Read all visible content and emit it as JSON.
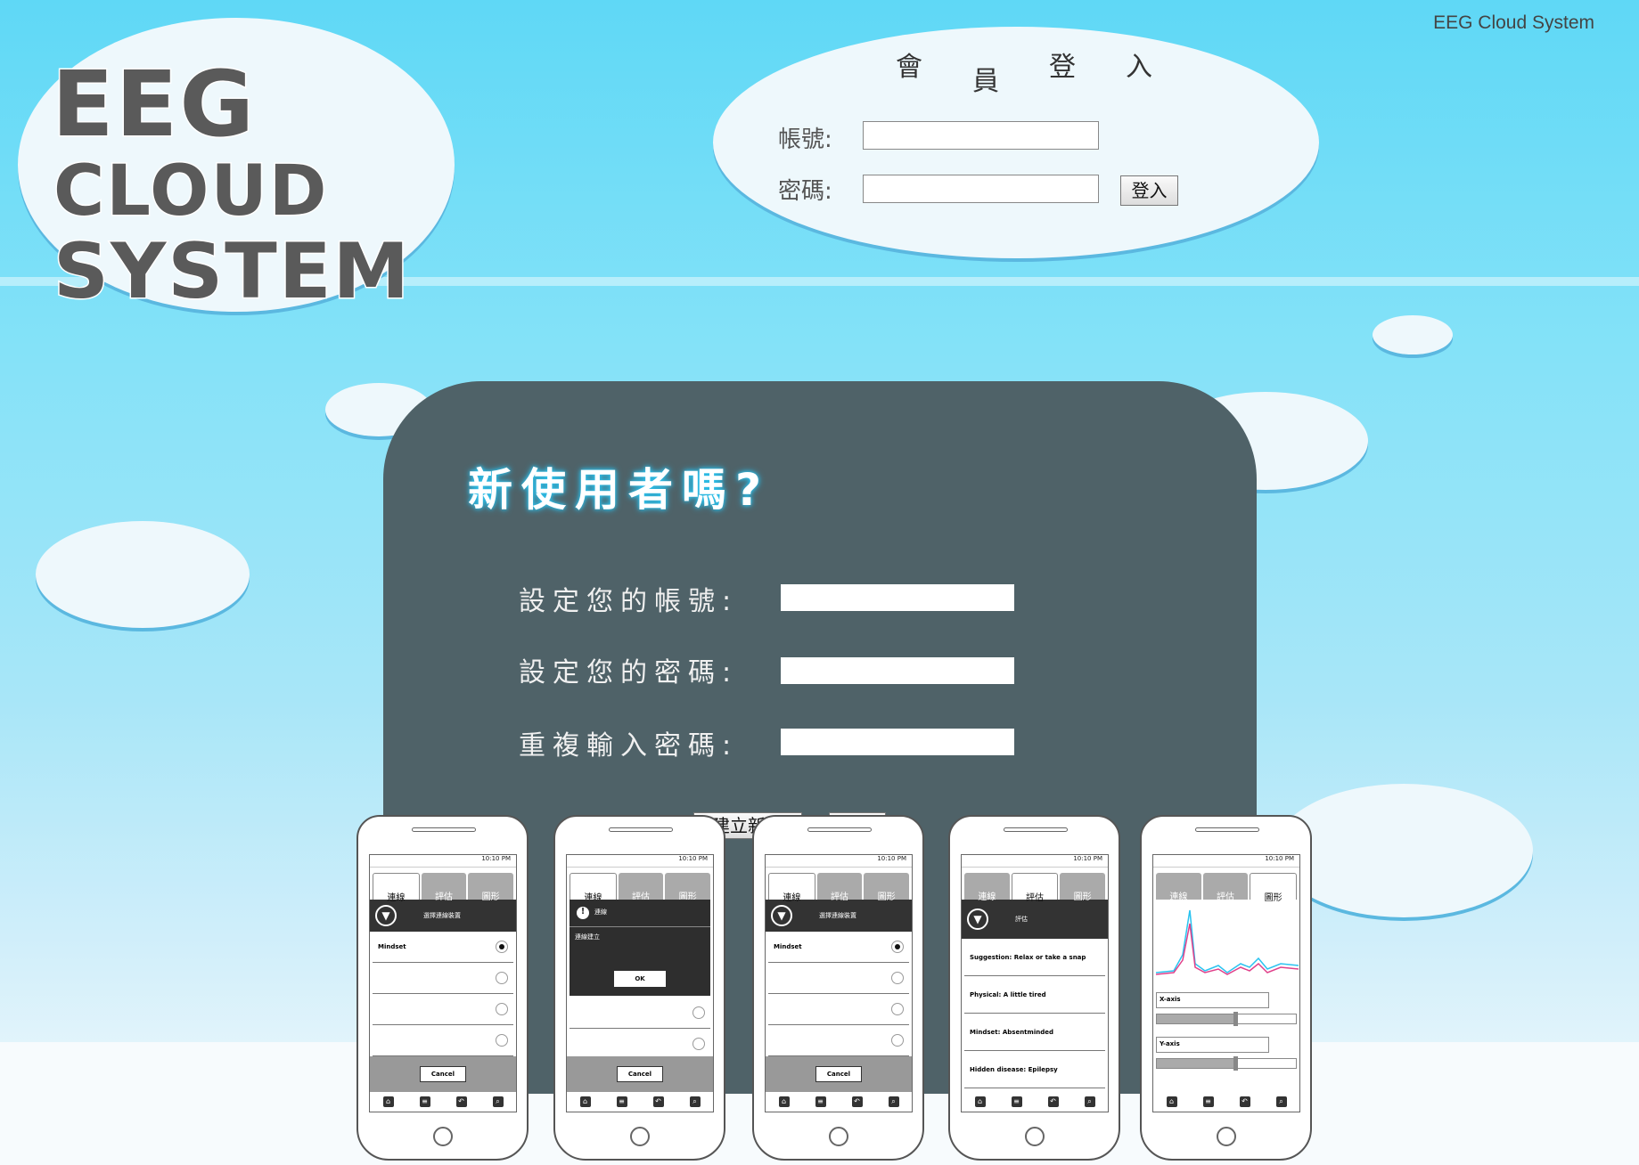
{
  "app_title": "EEG Cloud System",
  "logo": {
    "line1": "EEG",
    "line2": "CLOUD",
    "line3": "SYSTEM"
  },
  "login": {
    "title_chars": [
      "會",
      "員",
      "登",
      "入"
    ],
    "account_label": "帳號:",
    "password_label": "密碼:",
    "account_value": "",
    "password_value": "",
    "submit_label": "登入"
  },
  "register": {
    "title": "新使用者嗎?",
    "set_account_label": "設定您的帳號:",
    "set_password_label": "設定您的密碼:",
    "repeat_password_label": "重複輸入密碼:",
    "create_button_label": "建立新會"
  },
  "phones": {
    "status_time": "10:10 PM",
    "tabs": [
      "連線",
      "評估",
      "圖形"
    ],
    "phone1": {
      "header": "選擇連線裝置",
      "rows": [
        "Mindset",
        "",
        "",
        ""
      ],
      "cancel": "Cancel"
    },
    "phone2": {
      "dialog_title": "連線",
      "dialog_text": "連線建立",
      "ok": "OK",
      "cancel": "Cancel"
    },
    "phone3": {
      "header": "選擇連線裝置",
      "rows": [
        "Mindset",
        "",
        "",
        ""
      ],
      "cancel": "Cancel"
    },
    "phone4": {
      "header": "評估",
      "rows": [
        "Suggestion: Relax or take a snap",
        "Physical: A little tired",
        "Mindset: Absentminded",
        "Hidden disease: Epilepsy"
      ]
    },
    "phone5": {
      "x_label": "X-axis",
      "y_label": "Y-axis",
      "x_level": 0.55,
      "y_level": 0.55
    }
  },
  "colors": {
    "sky": "#5fd8f6",
    "panel": "#4f6268",
    "title_glow": "#2ac3f0"
  }
}
